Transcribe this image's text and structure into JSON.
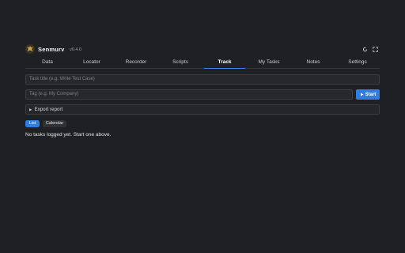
{
  "app": {
    "name": "Senmurv",
    "version": "v0.4.0",
    "logo_icon": "senmurv-logo-icon",
    "refresh_icon": "refresh-icon",
    "expand_icon": "expand-icon"
  },
  "tabs": [
    {
      "label": "Data"
    },
    {
      "label": "Locator"
    },
    {
      "label": "Recorder"
    },
    {
      "label": "Scripts"
    },
    {
      "label": "Track",
      "active": true
    },
    {
      "label": "My Tasks"
    },
    {
      "label": "Notes"
    },
    {
      "label": "Settings"
    }
  ],
  "track": {
    "task_title_placeholder": "Task title (e.g. Write Test Case)",
    "tag_placeholder": "Tag (e.g. My Company)",
    "start_label": "Start",
    "start_icon": "play-icon",
    "export_label": "Export report",
    "export_icon": "caret-right-icon",
    "view_list_label": "List",
    "view_calendar_label": "Calendar",
    "empty_message": "No tasks logged yet. Start one above."
  },
  "colors": {
    "background": "#1f2024",
    "accent": "#2f7de1"
  }
}
